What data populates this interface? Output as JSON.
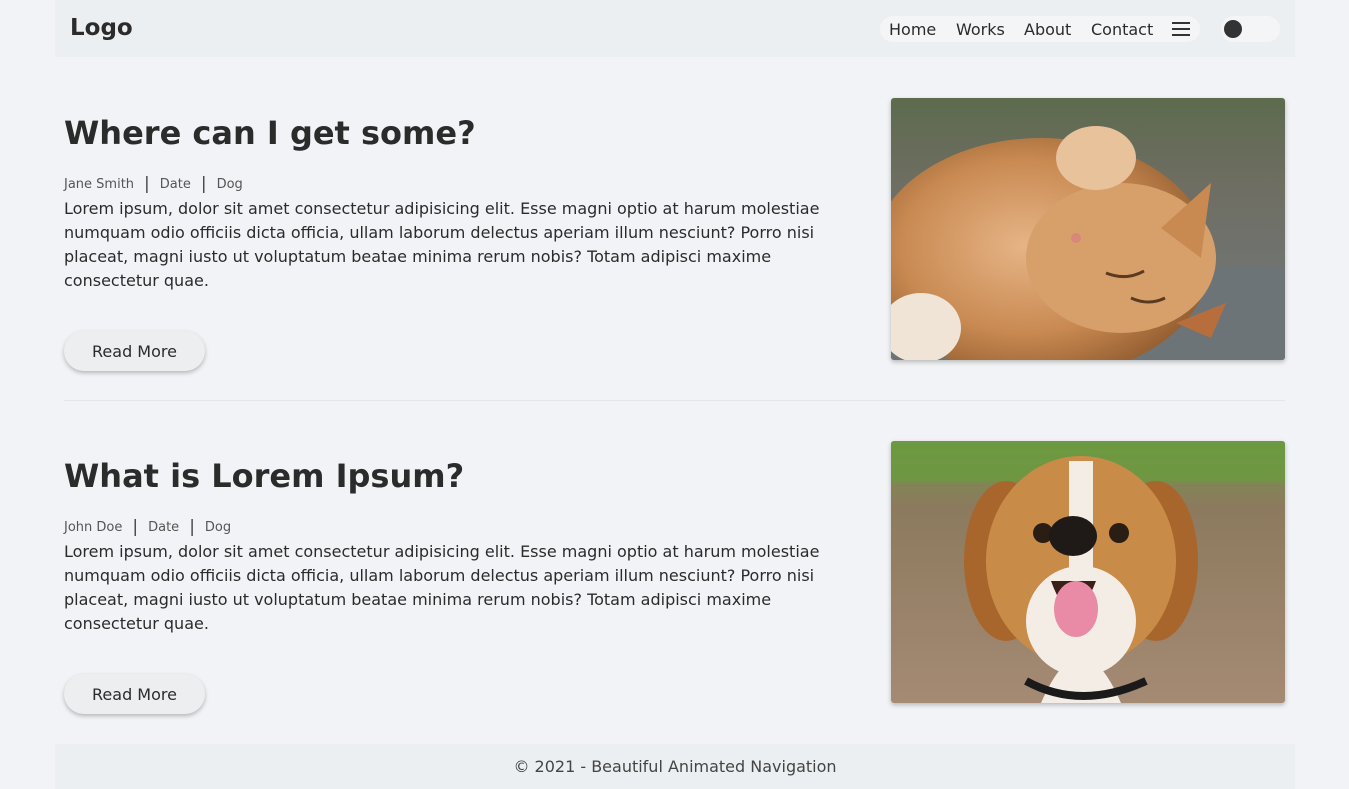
{
  "nav": {
    "logo": "Logo",
    "links": [
      "Home",
      "Works",
      "About",
      "Contact"
    ],
    "menu_icon": "hamburger-menu-icon",
    "theme_toggle_icon": "dark-mode-toggle"
  },
  "posts": [
    {
      "title": "Where can I get some?",
      "author": "Jane Smith",
      "date": "Date",
      "category": "Dog",
      "excerpt": "Lorem ipsum, dolor sit amet consectetur adipisicing elit. Esse magni optio at harum molestiae numquam odio officiis dicta officia, ullam laborum delectus aperiam illum nesciunt? Porro nisi placeat, magni iusto ut voluptatum beatae minima rerum nobis? Totam adipisci maxime consectetur quae.",
      "button": "Read More",
      "image": "cat-photo"
    },
    {
      "title": "What is Lorem Ipsum?",
      "author": "John Doe",
      "date": "Date",
      "category": "Dog",
      "excerpt": "Lorem ipsum, dolor sit amet consectetur adipisicing elit. Esse magni optio at harum molestiae numquam odio officiis dicta officia, ullam laborum delectus aperiam illum nesciunt? Porro nisi placeat, magni iusto ut voluptatum beatae minima rerum nobis? Totam adipisci maxime consectetur quae.",
      "button": "Read More",
      "image": "dog-photo"
    }
  ],
  "footer": {
    "text": "© 2021 - Beautiful Animated Navigation"
  },
  "colors": {
    "background": "#f1f3f6",
    "bar": "#eceff1",
    "text": "#2b2b2b"
  }
}
